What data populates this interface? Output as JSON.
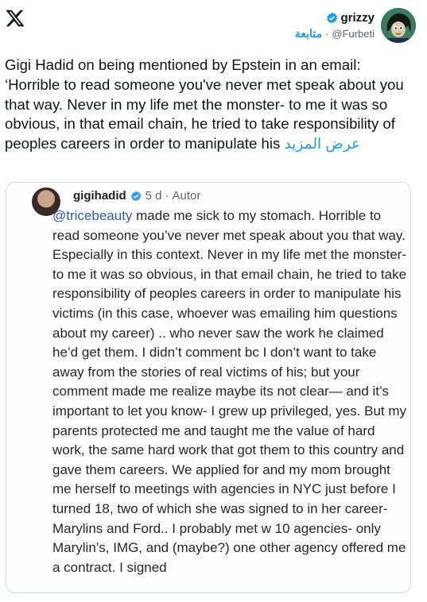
{
  "header": {
    "display_name": "grizzy",
    "handle": "@Furbeti",
    "follow_label": "متابعة",
    "separator": "·"
  },
  "tweet": {
    "text": "Gigi Hadid on being mentioned by Epstein in an email: ‘Horrible to read someone you've never met speak about you that way. Never in my life met the monster- to me it was so obvious, in that email chain, he tried to take responsibility of peoples careers in order to manipulate his",
    "show_more": "عرض المزيد"
  },
  "embedded_post": {
    "username": "gigihadid",
    "time": "5 d",
    "separator": "·",
    "role": "Autor",
    "mention": "@tricebeauty",
    "body": " made me sick to my stomach. Horrible to read someone you’ve never met speak about you that way. Especially in this context. Never in my life met the monster- to me it was so obvious, in that email chain, he tried to take responsibility of peoples careers in order to manipulate his victims (in this case, whoever was emailing him questions about my career) .. who never saw the work he claimed he’d get them. I didn’t comment bc I don’t want to take away from the stories of real victims of his; but your comment made me realize maybe its not clear— and it’s important to let you know- I grew up privileged, yes. But my parents protected me and taught me the value of hard work, the same hard work that got them to this country and gave them careers. We applied for and my  mom brought me herself to meetings with agencies in NYC just before I turned 18, two of which she was signed to in her career- Marylins and Ford.. I probably met w 10 agencies- only Marylin’s, IMG, and (maybe?) one other agency offered me a contract. I signed"
  },
  "icons": {
    "logo": "x-logo-icon",
    "verified": "verified-badge-icon"
  },
  "colors": {
    "accent": "#1d9bf0",
    "text": "#0f1419",
    "muted": "#536471",
    "mention": "#2f5fa3"
  }
}
